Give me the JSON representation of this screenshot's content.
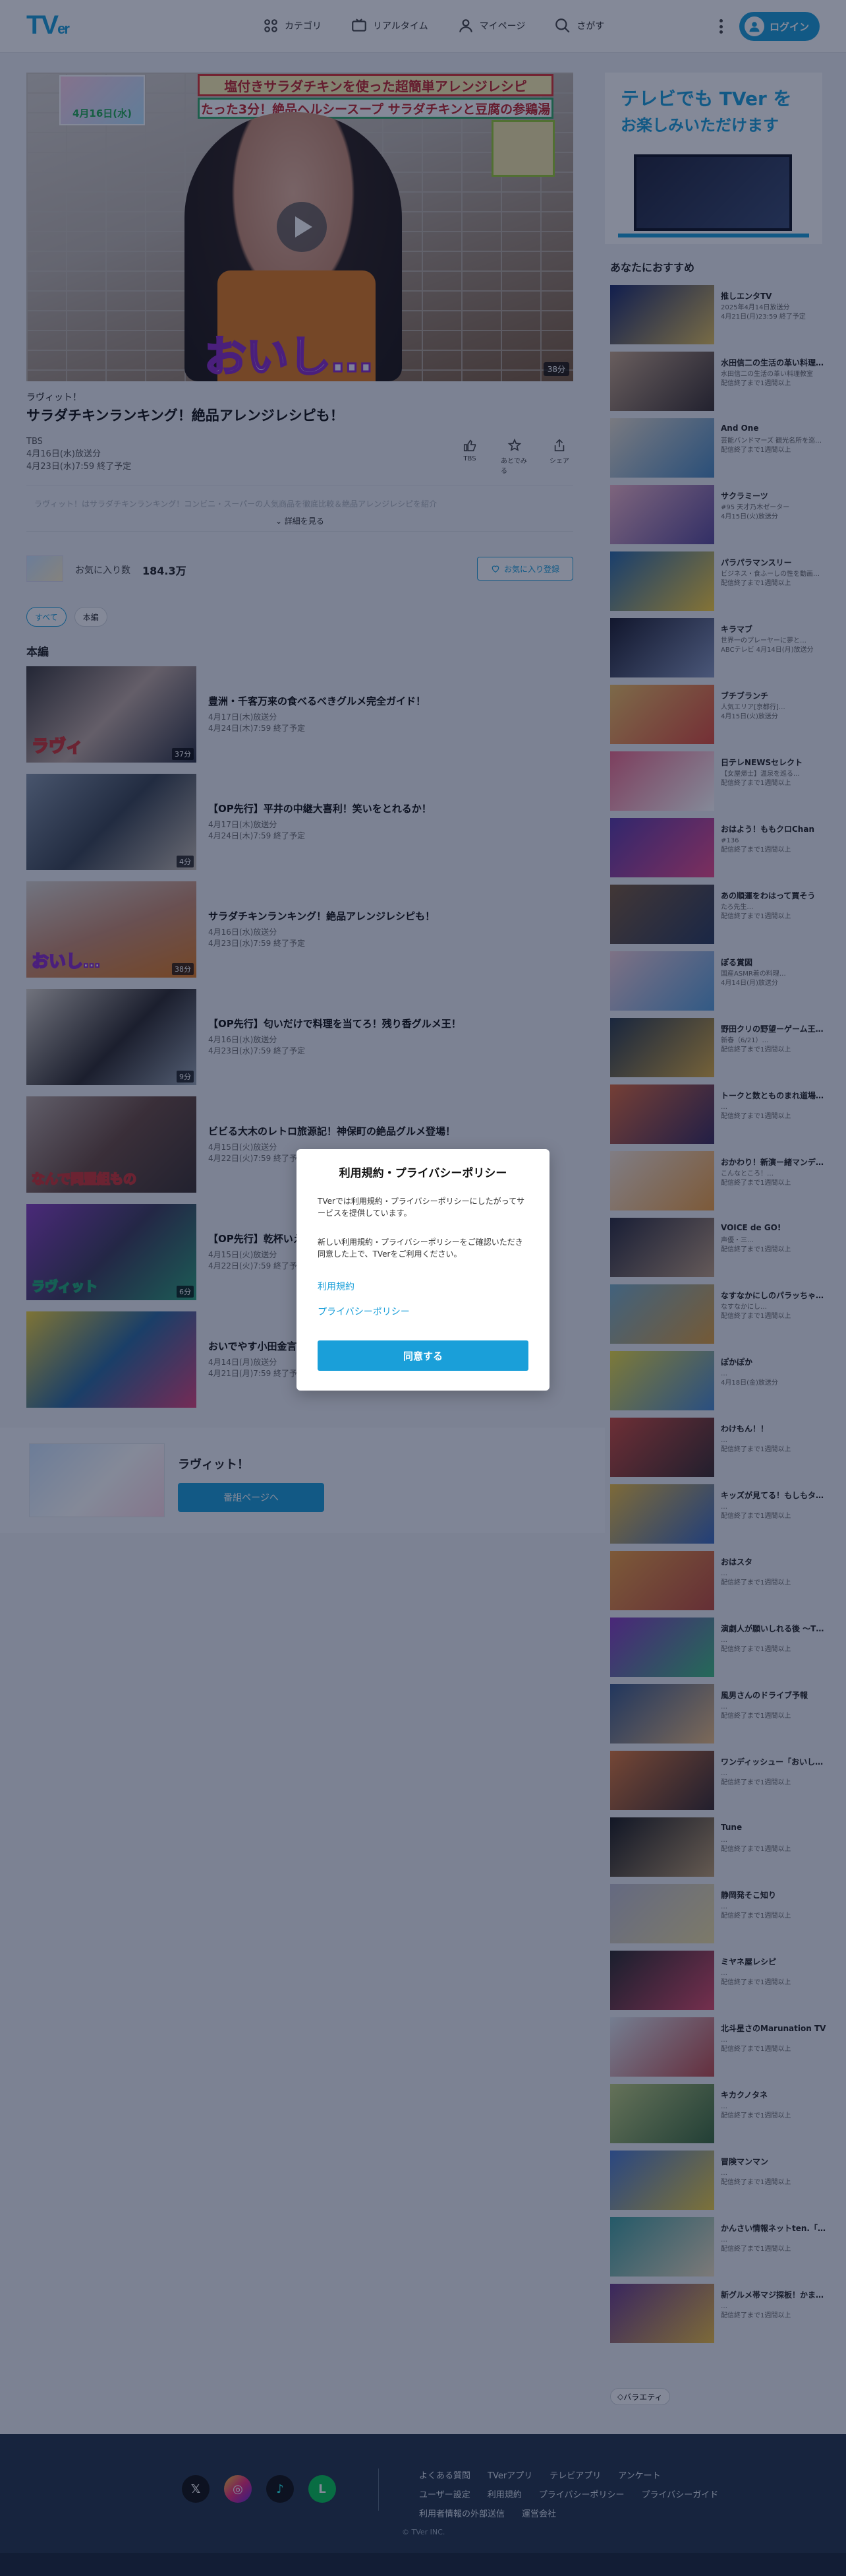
{
  "header": {
    "logo_main": "TV",
    "logo_sub": "er",
    "nav": [
      {
        "label": "カテゴリ",
        "icon": "grid-icon"
      },
      {
        "label": "リアルタイム",
        "icon": "tv-icon"
      },
      {
        "label": "マイページ",
        "icon": "user-icon"
      },
      {
        "label": "さがす",
        "icon": "search-icon"
      }
    ],
    "login_label": "ログイン"
  },
  "player": {
    "banner_top": "塩付きサラダチキンを使った超簡単アレンジレシピ",
    "banner_bottom": "たった3分！絶品ヘルシースープ サラダチキンと豆腐の参鶏湯",
    "badge": "4月16日(水)",
    "caption": "おいし…",
    "duration": "38分"
  },
  "episode": {
    "series": "ラヴィット！",
    "title": "サラダチキンランキング！絶品アレンジレシピも！",
    "broadcaster": "TBS",
    "aired": "4月16日(水)放送分",
    "expires": "4月23日(水)7:59 終了予定",
    "actions": [
      {
        "label": "TBS",
        "icon": "thumb-icon"
      },
      {
        "label": "あとでみる",
        "icon": "bookmark-icon"
      },
      {
        "label": "シェア",
        "icon": "share-icon"
      }
    ],
    "description": "ラヴィット！はサラダチキンランキング！コンビニ・スーパーの人気商品を徹底比較＆絶品アレンジレシピを紹介",
    "more_label": "詳細を見る"
  },
  "favorite": {
    "label": "お気に入り数",
    "count": "184.3万",
    "button": "お気に入り登録"
  },
  "tabs": [
    "すべて",
    "本編"
  ],
  "section_title": "本編",
  "episodes": [
    {
      "title": "豊洲・千客万来の食べるべきグルメ完全ガイド！",
      "aired": "4月17日(木)放送分",
      "expires": "4月24日(木)7:59 終了予定",
      "duration": "37分",
      "caption": "ラヴィ"
    },
    {
      "title": "【OP先行】平井の中継大喜利！笑いをとれるか！",
      "aired": "4月17日(木)放送分",
      "expires": "4月24日(木)7:59 終了予定",
      "duration": "4分",
      "caption": ""
    },
    {
      "title": "サラダチキンランキング！絶品アレンジレシピも！",
      "aired": "4月16日(水)放送分",
      "expires": "4月23日(水)7:59 終了予定",
      "duration": "38分",
      "caption": "おいし…"
    },
    {
      "title": "【OP先行】匂いだけで料理を当てろ！残り香グルメ王！",
      "aired": "4月16日(水)放送分",
      "expires": "4月23日(水)7:59 終了予定",
      "duration": "9分",
      "caption": ""
    },
    {
      "title": "ビビる大木のレトロ旅源記！神保町の絶品グルメ登場！",
      "aired": "4月15日(火)放送分",
      "expires": "4月22日(火)7:59 終了予定",
      "duration": "",
      "caption": "なんで同盟組もの"
    },
    {
      "title": "【OP先行】乾杯いえいえ選手権！",
      "aired": "4月15日(火)放送分",
      "expires": "4月22日(火)7:59 終了予定",
      "duration": "6分",
      "caption": "ラヴィット"
    },
    {
      "title": "おいでやす小田金言葉グルメ！",
      "aired": "4月14日(月)放送分",
      "expires": "4月21日(月)7:59 終了予定",
      "duration": "",
      "caption": ""
    }
  ],
  "series_footer": {
    "name": "ラヴィット！",
    "button": "番組ページへ"
  },
  "promo": {
    "line1": "テレビでも TVer を",
    "line2": "お楽しみいただけます"
  },
  "recommend": {
    "title": "あなたにおすすめ",
    "items": [
      {
        "title": "推しエンタTV",
        "meta": "2025年4月14日放送分",
        "sub": "4月21日(月)23:59 終了予定"
      },
      {
        "title": "水田信二の生活の革い料理…",
        "meta": "水田信二の生活の革い料理教室",
        "sub": "配信終了まで1週間以上"
      },
      {
        "title": "And One",
        "meta": "芸能バンドマーズ 観光名所を巡…",
        "sub": "配信終了まで1週間以上"
      },
      {
        "title": "サクラミーツ",
        "meta": "#95 天才乃木ゼーター",
        "sub": "4月15日(火)放送分"
      },
      {
        "title": "パラパラマンスリー",
        "meta": "ビジネス・食ふーしの性を動画…",
        "sub": "配信終了まで1週間以上"
      },
      {
        "title": "キラマブ",
        "meta": "世界一のプレーヤーに夢と…",
        "sub": "ABCテレビ 4月14日(月)放送分"
      },
      {
        "title": "ブチブランチ",
        "meta": "人気エリア[京都行]…",
        "sub": "4月15日(火)放送分"
      },
      {
        "title": "日テレNEWSセレクト",
        "meta": "【女屋帰士】温泉を巡る…",
        "sub": "配信終了まで1週間以上"
      },
      {
        "title": "おはよう！ももクロChan",
        "meta": "#136",
        "sub": "配信終了まで1週間以上"
      },
      {
        "title": "あの順運をわはって買そう",
        "meta": "たろ先生…",
        "sub": "配信終了まで1週間以上"
      },
      {
        "title": "ぽる賞図",
        "meta": "国産ASMR着の料理…",
        "sub": "4月14日(月)放送分"
      },
      {
        "title": "野田クリの野望ーゲーム王…",
        "meta": "新春（6/21）…",
        "sub": "配信終了まで1週間以上"
      },
      {
        "title": "トークと数とものまれ道場…",
        "meta": "…",
        "sub": "配信終了まで1週間以上"
      },
      {
        "title": "おかわり！新演ー緒マンデ…",
        "meta": "こんなところ！…",
        "sub": "配信終了まで1週間以上"
      },
      {
        "title": "VOICE de GO!",
        "meta": "声優・三…",
        "sub": "配信終了まで1週間以上"
      },
      {
        "title": "なすなかにしのパラッちゃ…",
        "meta": "なすなかにし…",
        "sub": "配信終了まで1週間以上"
      },
      {
        "title": "ぽかぽか",
        "meta": "…",
        "sub": "4月18日(金)放送分"
      },
      {
        "title": "わけもん！！",
        "meta": "…",
        "sub": "配信終了まで1週間以上"
      },
      {
        "title": "キッズが見てる！もしもタ…",
        "meta": "…",
        "sub": "配信終了まで1週間以上"
      },
      {
        "title": "おはスタ",
        "meta": "…",
        "sub": "配信終了まで1週間以上"
      },
      {
        "title": "演劇人が願いしれる後 ～T…",
        "meta": "…",
        "sub": "配信終了まで1週間以上"
      },
      {
        "title": "風男さんのドライブ予報",
        "meta": "…",
        "sub": "配信終了まで1週間以上"
      },
      {
        "title": "ワンディッシュー「おいし…",
        "meta": "…",
        "sub": "配信終了まで1週間以上"
      },
      {
        "title": "Tune",
        "meta": "…",
        "sub": "配信終了まで1週間以上"
      },
      {
        "title": "静岡発そこ知り",
        "meta": "…",
        "sub": "配信終了まで1週間以上"
      },
      {
        "title": "ミヤネ屋レシピ",
        "meta": "…",
        "sub": "配信終了まで1週間以上"
      },
      {
        "title": "北斗星さのMarunation TV",
        "meta": "…",
        "sub": "配信終了まで1週間以上"
      },
      {
        "title": "キカクノタネ",
        "meta": "…",
        "sub": "配信終了まで1週間以上"
      },
      {
        "title": "冒険マンマン",
        "meta": "…",
        "sub": "配信終了まで1週間以上"
      },
      {
        "title": "かんさい情報ネットten.「…",
        "meta": "…",
        "sub": "配信終了まで1週間以上"
      },
      {
        "title": "新グルメ帯マジ探板！かま…",
        "meta": "…",
        "sub": "配信終了まで1週間以上"
      }
    ],
    "genre_tag": "バラエティ"
  },
  "footer": {
    "social": [
      {
        "label": "𝕏",
        "icon": "x-icon",
        "color": "#111111"
      },
      {
        "label": "◎",
        "icon": "instagram-icon",
        "color": "#c13584"
      },
      {
        "label": "♪",
        "icon": "tiktok-icon",
        "color": "#111111"
      },
      {
        "label": "L",
        "icon": "line-icon",
        "color": "#06c755"
      }
    ],
    "links": [
      "よくある質問",
      "TVerアプリ",
      "テレビアプリ",
      "アンケート",
      "ユーザー設定",
      "利用規約",
      "プライバシーポリシー",
      "プライバシーガイド",
      "利用者情報の外部送信",
      "運営会社"
    ],
    "copyright": "© TVer INC."
  },
  "modal": {
    "title": "利用規約・プライバシーポリシー",
    "para1": "TVerでは利用規約・プライバシーポリシーにしたがってサービスを提供しています。",
    "para2": "新しい利用規約・プライバシーポリシーをご確認いただき同意した上で、TVerをご利用ください。",
    "link_terms": "利用規約",
    "link_privacy": "プライバシーポリシー",
    "agree_button": "同意する"
  },
  "colors": {
    "brand": "#1a9fd9",
    "footer": "#24354a"
  }
}
